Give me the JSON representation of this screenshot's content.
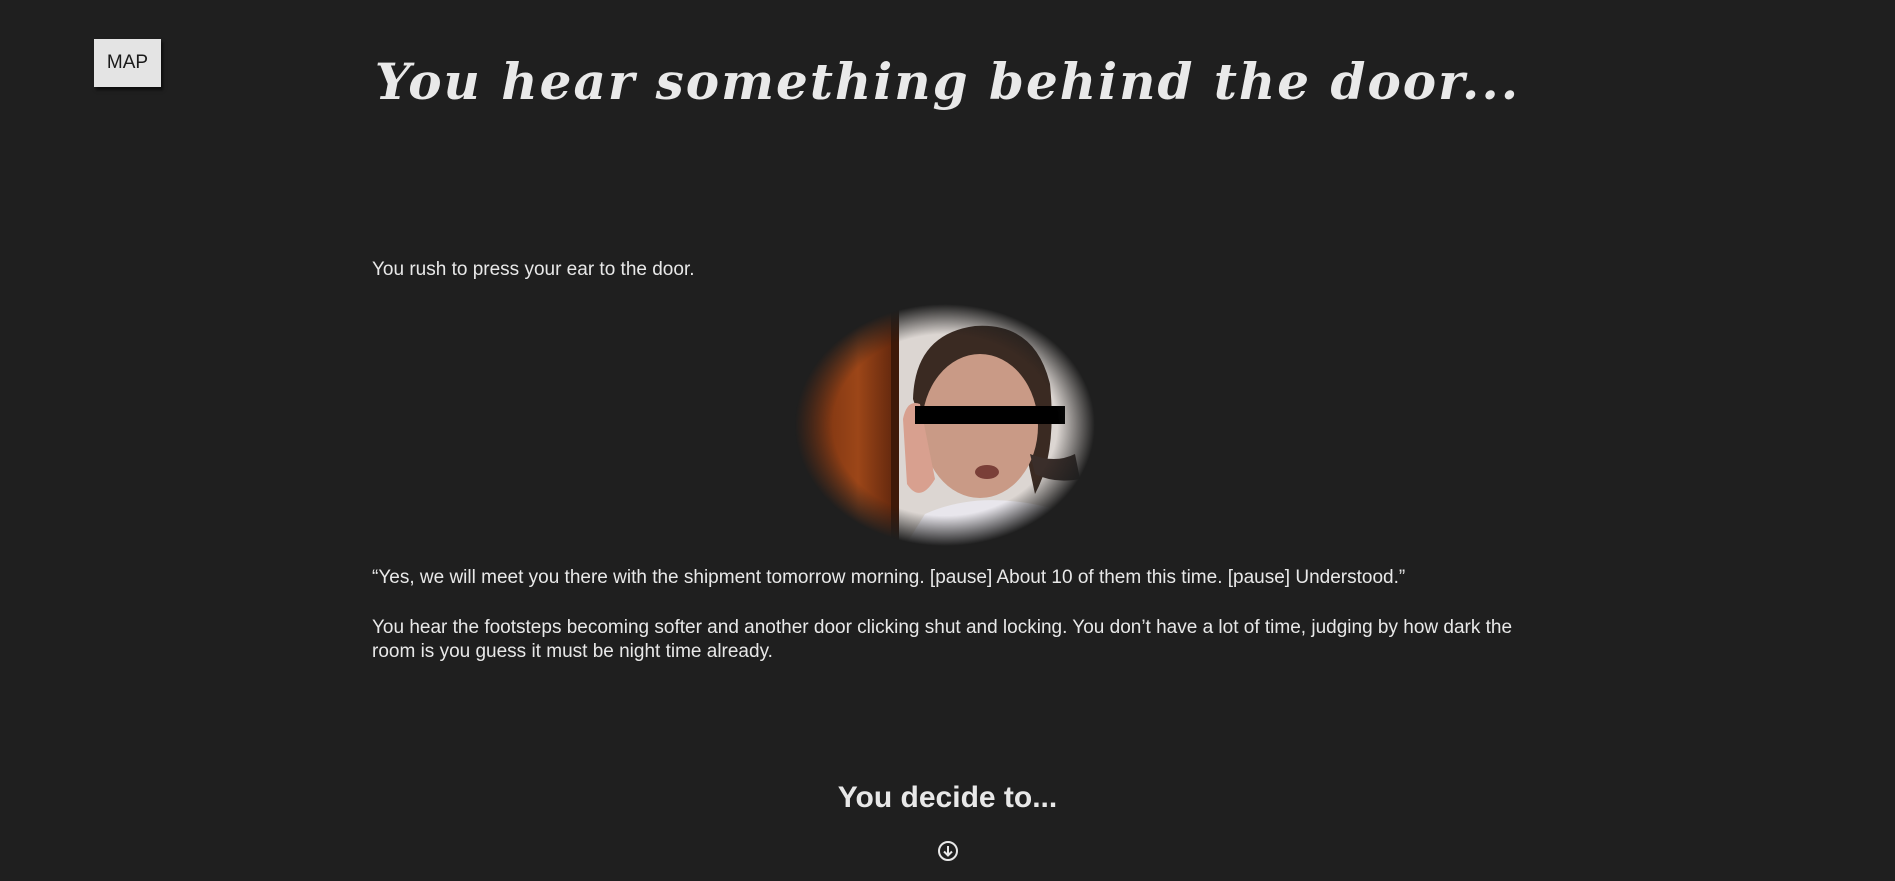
{
  "nav": {
    "map_label": "MAP"
  },
  "header": {
    "title": "You hear something behind the door..."
  },
  "story": {
    "paragraph_1": "You rush to press your ear to the door.",
    "paragraph_2": "“Yes, we will meet you there with the shipment tomorrow morning. [pause] About 10 of them this time. [pause] Understood.”",
    "paragraph_3": "You hear the footsteps becoming softer and another door clicking shut and locking. You don’t have a lot of time, judging by how dark the room is you guess it must be night time already."
  },
  "choice": {
    "prompt": "You decide to...",
    "scroll_icon": "circle-arrow-down-icon"
  },
  "colors": {
    "background": "#1f1f1f",
    "text": "#e8e8e8",
    "button_bg": "#e4e4e4"
  }
}
